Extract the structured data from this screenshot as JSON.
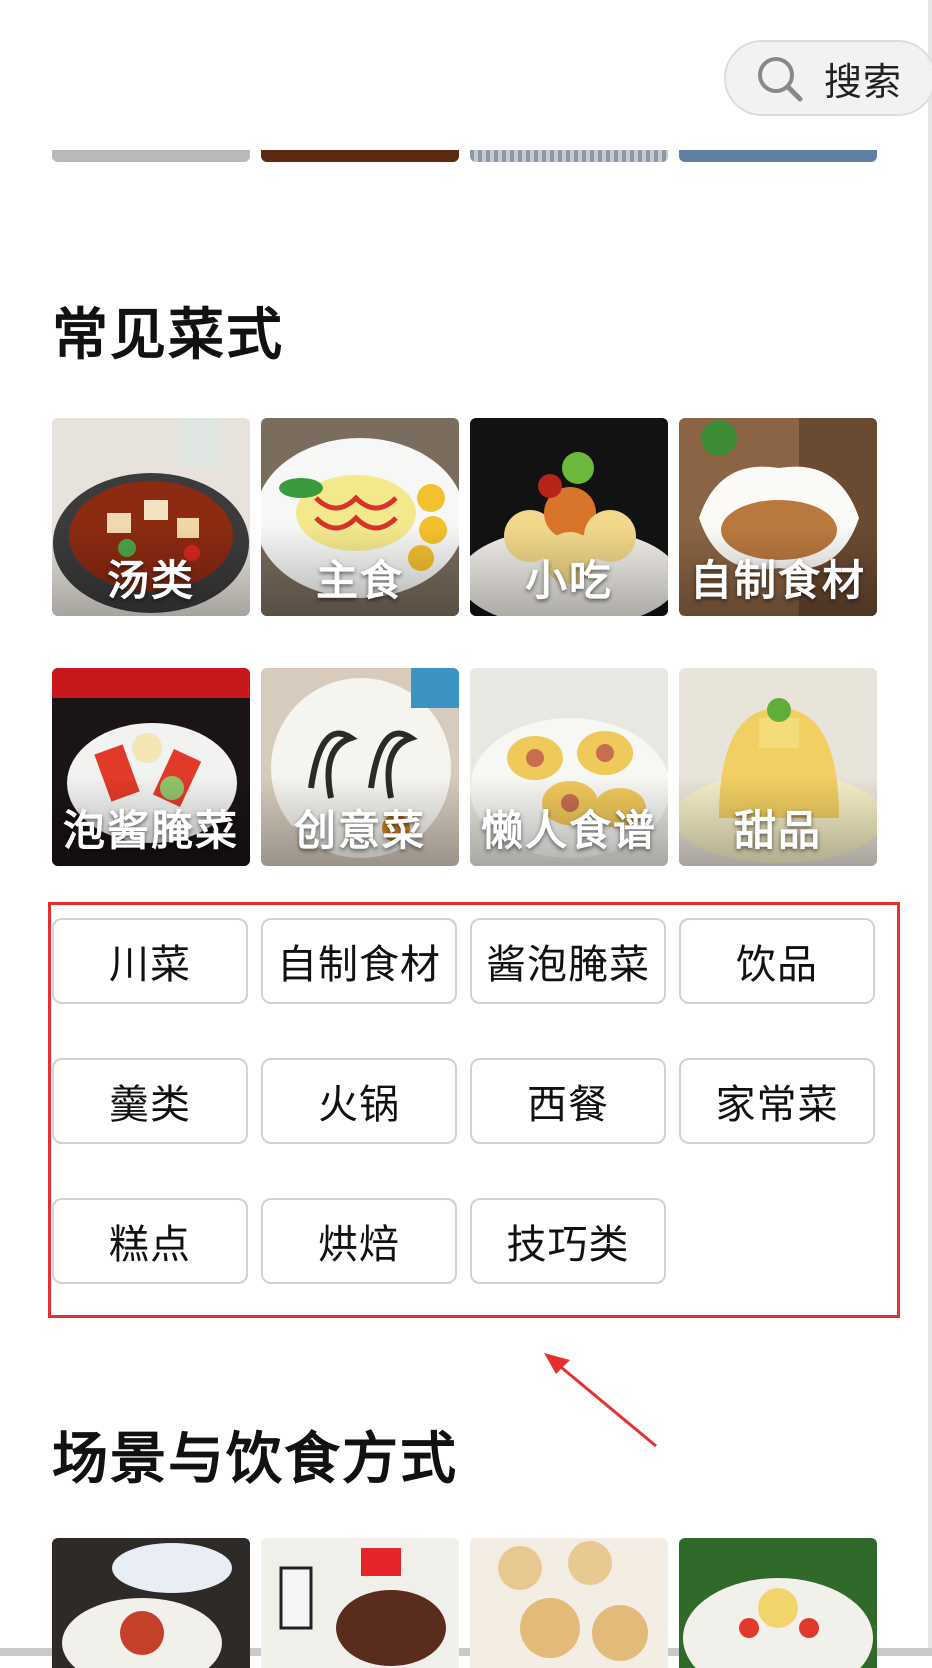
{
  "search": {
    "label": "搜索",
    "icon": "search-icon"
  },
  "sections": {
    "common_dishes": {
      "title": "常见菜式",
      "tiles": [
        {
          "label": "汤类"
        },
        {
          "label": "主食"
        },
        {
          "label": "小吃"
        },
        {
          "label": "自制食材"
        },
        {
          "label": "泡酱腌菜"
        },
        {
          "label": "创意菜"
        },
        {
          "label": "懒人食谱"
        },
        {
          "label": "甜品"
        }
      ],
      "tags": [
        "川菜",
        "自制食材",
        "酱泡腌菜",
        "饮品",
        "羹类",
        "火锅",
        "西餐",
        "家常菜",
        "糕点",
        "烘焙",
        "技巧类"
      ]
    },
    "scenes": {
      "title": "场景与饮食方式"
    }
  },
  "colors": {
    "highlight": "#e53030",
    "tag_border": "#d2d2d2"
  }
}
